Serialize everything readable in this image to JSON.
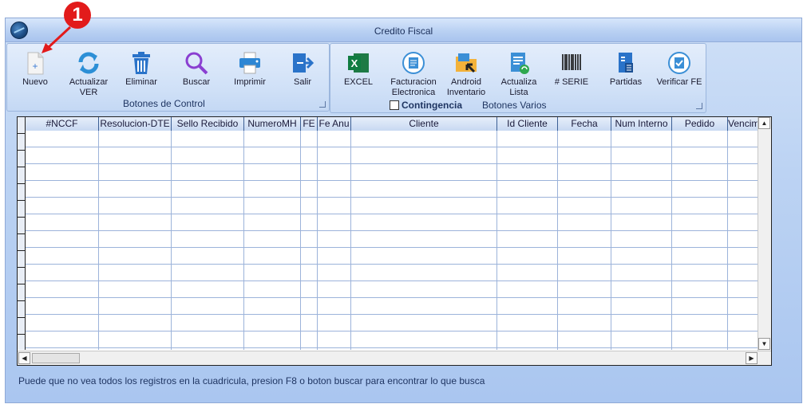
{
  "window": {
    "title": "Credito Fiscal"
  },
  "annotation": {
    "number": "1"
  },
  "control_group": {
    "label": "Botones de Control",
    "buttons": [
      {
        "label": "Nuevo",
        "icon": "new-file-icon"
      },
      {
        "label": "Actualizar\nVER",
        "icon": "refresh-icon"
      },
      {
        "label": "Eliminar",
        "icon": "trash-icon"
      },
      {
        "label": "Buscar",
        "icon": "search-icon"
      },
      {
        "label": "Imprimir",
        "icon": "printer-icon"
      },
      {
        "label": "Salir",
        "icon": "exit-icon"
      }
    ]
  },
  "varios_group": {
    "label": "Botones Varios",
    "checkbox_label": "Contingencia",
    "buttons": [
      {
        "label": "EXCEL",
        "icon": "excel-icon"
      },
      {
        "label": "Facturacion\nElectronica",
        "icon": "e-invoice-badge-icon"
      },
      {
        "label": "Android\nInventario",
        "icon": "folder-arrow-icon"
      },
      {
        "label": "Actualiza\nLista",
        "icon": "list-refresh-icon"
      },
      {
        "label": "# SERIE",
        "icon": "barcode-icon"
      },
      {
        "label": "Partidas",
        "icon": "calculator-doc-icon"
      },
      {
        "label": "Verificar FE",
        "icon": "e-invoice-check-icon"
      }
    ]
  },
  "grid": {
    "columns": [
      "#NCCF",
      "Resolucion-DTE",
      "Sello Recibido",
      "NumeroMH",
      "FE",
      "Fe Anu",
      "Cliente",
      "Id Cliente",
      "Fecha",
      "Num Interno",
      "Pedido",
      "Vencim"
    ]
  },
  "status_text": "Puede que no vea todos los registros en la cuadricula, presion F8 o boton buscar para encontrar lo que busca",
  "colors": {
    "accent": "#e21b1b",
    "header_text": "#1f3562"
  }
}
